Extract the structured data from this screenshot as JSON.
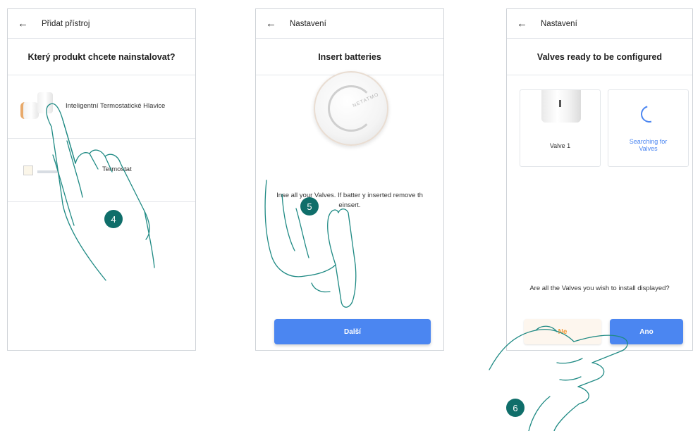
{
  "screens": [
    {
      "back_icon": "arrow-left-icon",
      "title": "Přidat přístroj",
      "heading": "Který produkt chcete nainstalovat?",
      "products": [
        {
          "label": "Inteligentní Termostatické Hlavice",
          "icon": "valve-image"
        },
        {
          "label": "Termostat",
          "icon": "thermostat-image"
        }
      ],
      "step": "4"
    },
    {
      "back_icon": "arrow-left-icon",
      "title": "Nastavení",
      "heading": "Insert batteries",
      "dial_brand": "NETATMO",
      "instructions": "Inse              all your Valves. If batter               y inserted remove th              einsert.",
      "button": "Další",
      "step": "5"
    },
    {
      "back_icon": "arrow-left-icon",
      "title": "Nastavení",
      "heading": "Valves ready to be configured",
      "cards": [
        {
          "label": "Valve 1",
          "icon": "valve-image"
        },
        {
          "label": "Searching for Valves",
          "icon": "spinner-icon"
        }
      ],
      "question": "Are all the Valves you wish to install displayed?",
      "buttons": {
        "no": "Ne",
        "yes": "Ano"
      },
      "step": "6"
    }
  ],
  "colors": {
    "primary": "#4b86f1",
    "badge": "#0f6e6a",
    "no_text": "#f29b3a",
    "hand_stroke": "#1f8a84"
  }
}
